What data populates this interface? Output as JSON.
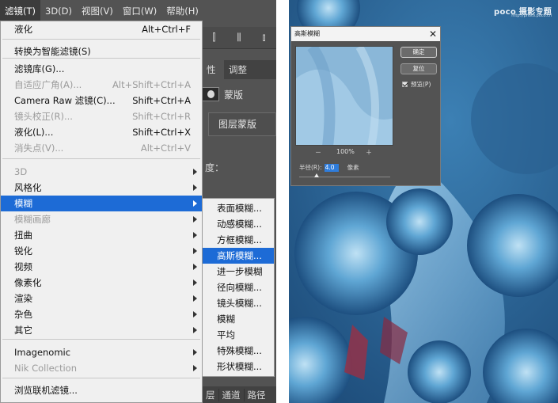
{
  "menubar": {
    "items": [
      "滤镜(T)",
      "3D(D)",
      "视图(V)",
      "窗口(W)",
      "帮助(H)"
    ],
    "active_index": 0
  },
  "panel": {
    "tabs": [
      "性",
      "调整"
    ],
    "mask_label": "蒙版",
    "layer_mask_label": "图层蒙版",
    "colon_text": "度：",
    "bottom_tabs": [
      "层",
      "通道",
      "路径"
    ]
  },
  "filter_menu": {
    "items": [
      {
        "label": "液化",
        "shortcut": "Alt+Ctrl+F",
        "disabled": false,
        "submenu": false
      },
      {
        "label": "转换为智能滤镜(S)",
        "shortcut": "",
        "disabled": false,
        "submenu": false
      },
      {
        "label": "滤镜库(G)...",
        "shortcut": "",
        "disabled": false,
        "submenu": false
      },
      {
        "label": "自适应广角(A)...",
        "shortcut": "Alt+Shift+Ctrl+A",
        "disabled": true,
        "submenu": false
      },
      {
        "label": "Camera Raw 滤镜(C)...",
        "shortcut": "Shift+Ctrl+A",
        "disabled": false,
        "submenu": false
      },
      {
        "label": "镜头校正(R)...",
        "shortcut": "Shift+Ctrl+R",
        "disabled": true,
        "submenu": false
      },
      {
        "label": "液化(L)...",
        "shortcut": "Shift+Ctrl+X",
        "disabled": false,
        "submenu": false
      },
      {
        "label": "消失点(V)...",
        "shortcut": "Alt+Ctrl+V",
        "disabled": true,
        "submenu": false
      },
      {
        "label": "3D",
        "shortcut": "",
        "disabled": true,
        "submenu": true
      },
      {
        "label": "风格化",
        "shortcut": "",
        "disabled": false,
        "submenu": true
      },
      {
        "label": "模糊",
        "shortcut": "",
        "disabled": false,
        "submenu": true,
        "highlighted": true
      },
      {
        "label": "模糊画廊",
        "shortcut": "",
        "disabled": true,
        "submenu": true
      },
      {
        "label": "扭曲",
        "shortcut": "",
        "disabled": false,
        "submenu": true
      },
      {
        "label": "锐化",
        "shortcut": "",
        "disabled": false,
        "submenu": true
      },
      {
        "label": "视频",
        "shortcut": "",
        "disabled": false,
        "submenu": true
      },
      {
        "label": "像素化",
        "shortcut": "",
        "disabled": false,
        "submenu": true
      },
      {
        "label": "渲染",
        "shortcut": "",
        "disabled": false,
        "submenu": true
      },
      {
        "label": "杂色",
        "shortcut": "",
        "disabled": false,
        "submenu": true
      },
      {
        "label": "其它",
        "shortcut": "",
        "disabled": false,
        "submenu": true
      },
      {
        "label": "Imagenomic",
        "shortcut": "",
        "disabled": false,
        "submenu": true
      },
      {
        "label": "Nik Collection",
        "shortcut": "",
        "disabled": true,
        "submenu": true
      },
      {
        "label": "浏览联机滤镜...",
        "shortcut": "",
        "disabled": false,
        "submenu": false
      }
    ]
  },
  "blur_submenu": {
    "items": [
      "表面模糊...",
      "动感模糊...",
      "方框模糊...",
      "高斯模糊...",
      "进一步模糊",
      "径向模糊...",
      "镜头模糊...",
      "模糊",
      "平均",
      "特殊模糊...",
      "形状模糊..."
    ],
    "highlighted_index": 3
  },
  "dialog": {
    "title": "高斯模糊",
    "ok_label": "确定",
    "reset_label": "复位",
    "preview_label": "预览(P)",
    "preview_checked": true,
    "zoom_label": "100%",
    "zoom_out_icon": "－",
    "zoom_in_icon": "＋",
    "radius_label": "半径(R):",
    "radius_value": "4.0",
    "radius_unit": "像素",
    "close_icon": "✕"
  },
  "watermark": {
    "brand": "poco 摄影专题",
    "sub": "http://photo.poco.cn"
  },
  "colors": {
    "highlight": "#1d6bd6",
    "menu_bg": "#f0f0f0",
    "ps_dark": "#535353",
    "photo_blue": "#2f6a9a"
  }
}
